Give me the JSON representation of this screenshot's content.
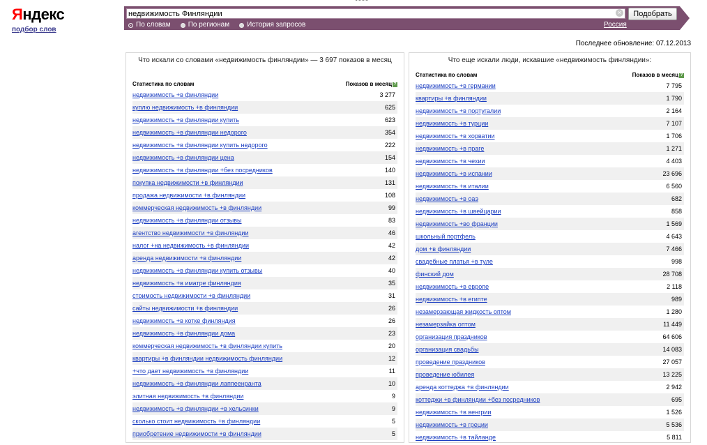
{
  "header": {
    "logo_first": "Я",
    "logo_rest": "ндекс",
    "subtitle_link": "подбор слов"
  },
  "search": {
    "query": "недвижимость Финляндии",
    "button_label": "Подобрать",
    "clear_glyph": "×",
    "modes": [
      {
        "label": "По словам",
        "checked": true
      },
      {
        "label": "По регионам",
        "checked": false
      },
      {
        "label": "История запросов",
        "checked": false
      }
    ],
    "region": "Россия"
  },
  "last_update": "Последнее обновление: 07.12.2013",
  "left_panel": {
    "title": "Что искали со словами «недвижимость финляндии» — 3 697 показов в месяц",
    "col_stat": "Статистика по словам",
    "col_count": "Показов в месяц",
    "help": "?",
    "rows": [
      {
        "q": "недвижимость +в финляндии",
        "n": "3 277"
      },
      {
        "q": "куплю недвижимость +в финляндии",
        "n": "625"
      },
      {
        "q": "недвижимость +в финляндии купить",
        "n": "623"
      },
      {
        "q": "недвижимость +в финляндии недорого",
        "n": "354"
      },
      {
        "q": "недвижимость +в финляндии купить недорого",
        "n": "222"
      },
      {
        "q": "недвижимость +в финляндии цена",
        "n": "154"
      },
      {
        "q": "недвижимость +в финляндии +без посредников",
        "n": "140"
      },
      {
        "q": "покупка недвижимости +в финляндии",
        "n": "131"
      },
      {
        "q": "продажа недвижимости +в финляндии",
        "n": "108"
      },
      {
        "q": "коммерческая недвижимость +в финляндии",
        "n": "99"
      },
      {
        "q": "недвижимость +в финляндии отзывы",
        "n": "83"
      },
      {
        "q": "агентство недвижимости +в финляндии",
        "n": "46"
      },
      {
        "q": "налог +на недвижимость +в финляндии",
        "n": "42"
      },
      {
        "q": "аренда недвижимости +в финляндии",
        "n": "42"
      },
      {
        "q": "недвижимость +в финляндии купить отзывы",
        "n": "40"
      },
      {
        "q": "недвижимость +в иматре финляндия",
        "n": "35"
      },
      {
        "q": "стоимость недвижимости +в финляндии",
        "n": "31"
      },
      {
        "q": "сайты недвижимости +в финляндии",
        "n": "26"
      },
      {
        "q": "недвижимость +в котке финляндия",
        "n": "26"
      },
      {
        "q": "недвижимость +в финляндии дома",
        "n": "23"
      },
      {
        "q": "коммерческая недвижимость +в финляндии купить",
        "n": "20"
      },
      {
        "q": "квартиры +в финляндии недвижимость финляндии",
        "n": "12"
      },
      {
        "q": "+что дает недвижимость +в финляндии",
        "n": "11"
      },
      {
        "q": "недвижимость +в финляндии лаппеенранта",
        "n": "10"
      },
      {
        "q": "элитная недвижимость +в финляндии",
        "n": "9"
      },
      {
        "q": "недвижимость +в финляндии +в хельсинки",
        "n": "9"
      },
      {
        "q": "сколько стоит недвижимость +в финляндии",
        "n": "5"
      },
      {
        "q": "приобретение недвижимости +в финляндии",
        "n": "5"
      }
    ]
  },
  "right_panel": {
    "title": "Что еще искали люди, искавшие «недвижимость финляндии»:",
    "col_stat": "Статистика по словам",
    "col_count": "Показов в месяц",
    "help": "?",
    "rows": [
      {
        "q": "недвижимость +в германии",
        "n": "7 795"
      },
      {
        "q": "квартиры +в финляндии",
        "n": "1 790"
      },
      {
        "q": "недвижимость +в португалии",
        "n": "2 164"
      },
      {
        "q": "недвижимость +в турции",
        "n": "7 107"
      },
      {
        "q": "недвижимость +в хорватии",
        "n": "1 706"
      },
      {
        "q": "недвижимость +в праге",
        "n": "1 271"
      },
      {
        "q": "недвижимость +в чехии",
        "n": "4 403"
      },
      {
        "q": "недвижимость +в испании",
        "n": "23 696"
      },
      {
        "q": "недвижимость +в италии",
        "n": "6 560"
      },
      {
        "q": "недвижимость +в оаэ",
        "n": "682"
      },
      {
        "q": "недвижимость +в швейцарии",
        "n": "858"
      },
      {
        "q": "недвижимость +во франции",
        "n": "1 569"
      },
      {
        "q": "школьный портфель",
        "n": "4 643"
      },
      {
        "q": "дом +в финляндии",
        "n": "7 466"
      },
      {
        "q": "свадебные платья +в туле",
        "n": "998"
      },
      {
        "q": "финский дом",
        "n": "28 708"
      },
      {
        "q": "недвижимость +в европе",
        "n": "2 118"
      },
      {
        "q": "недвижимость +в египте",
        "n": "989"
      },
      {
        "q": "незамерзающая жидкость оптом",
        "n": "1 280"
      },
      {
        "q": "незамерзайка оптом",
        "n": "11 449"
      },
      {
        "q": "организация праздников",
        "n": "64 606"
      },
      {
        "q": "организация свадьбы",
        "n": "14 083"
      },
      {
        "q": "проведение праздников",
        "n": "27 057"
      },
      {
        "q": "проведение юбилея",
        "n": "13 225"
      },
      {
        "q": "аренда коттеджа +в финляндии",
        "n": "2 942"
      },
      {
        "q": "коттеджи +в финляндии +без посредников",
        "n": "695"
      },
      {
        "q": "недвижимость +в венгрии",
        "n": "1 526"
      },
      {
        "q": "недвижимость +в греции",
        "n": "5 536"
      },
      {
        "q": "недвижимость +в тайланде",
        "n": "5 811"
      }
    ]
  },
  "colors": {
    "bar": "#7b4f6f",
    "link": "#1a3dc1",
    "logo_red": "#ff0000",
    "help_icon": "#5f9a4c"
  }
}
